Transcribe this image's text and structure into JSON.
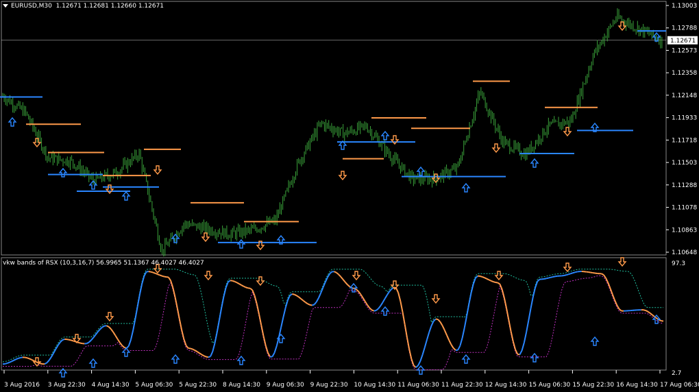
{
  "main_header": {
    "symbol": "EURUSD,M30",
    "ohlc": "1.12671 1.12681 1.12660 1.12671"
  },
  "indicator_header": {
    "text": "vkw bands of RSX (10,3,16,7) 56.9965 51.1367 46.4027 46.4027"
  },
  "price_axis": {
    "labels": [
      "1.13003",
      "1.12788",
      "1.12573",
      "1.12358",
      "1.12148",
      "1.11933",
      "1.11718",
      "1.11503",
      "1.11288",
      "1.11078",
      "1.10863",
      "1.10648"
    ],
    "current_price": "1.12671"
  },
  "indicator_axis": {
    "top": "97.3",
    "bottom": "2.7"
  },
  "time_axis": {
    "labels": [
      "3 Aug 2016",
      "3 Aug 22:30",
      "4 Aug 14:30",
      "5 Aug 06:30",
      "5 Aug 22:30",
      "8 Aug 14:30",
      "9 Aug 06:30",
      "9 Aug 22:30",
      "10 Aug 14:30",
      "11 Aug 06:30",
      "11 Aug 22:30",
      "12 Aug 14:30",
      "15 Aug 06:30",
      "15 Aug 22:30",
      "16 Aug 14:30",
      "17 Aug 06:30"
    ]
  },
  "colors": {
    "background": "#000000",
    "candles": "#3aa33a",
    "resistance": "#ff9a4a",
    "support": "#2a86ff",
    "rsx_up": "#2a86ff",
    "rsx_down": "#ff9a4a",
    "band_upper": "#20c0a0",
    "band_lower": "#c030c0",
    "axis_text": "#ffffff",
    "grid": "#cccccc"
  },
  "chart_data": {
    "type": "line",
    "title": "EURUSD,M30",
    "x": [
      "3 Aug 2016",
      "3 Aug 22:30",
      "4 Aug 14:30",
      "5 Aug 06:30",
      "5 Aug 22:30",
      "8 Aug 14:30",
      "9 Aug 06:30",
      "9 Aug 22:30",
      "10 Aug 14:30",
      "11 Aug 06:30",
      "11 Aug 22:30",
      "12 Aug 14:30",
      "15 Aug 06:30",
      "15 Aug 22:30",
      "16 Aug 14:30",
      "17 Aug 06:30"
    ],
    "ylim": [
      1.10648,
      1.13003
    ],
    "series": [
      {
        "values": [
          1.1214,
          1.1198,
          1.1155,
          1.1152,
          1.1133,
          1.1141,
          1.1159,
          1.1066,
          1.1092,
          1.1087,
          1.1082,
          1.1086,
          1.1095,
          1.115,
          1.1188,
          1.1178,
          1.1185,
          1.1158,
          1.1135,
          1.1135,
          1.1145,
          1.1218,
          1.117,
          1.1158,
          1.1185,
          1.119,
          1.1254,
          1.1289,
          1.1278,
          1.1267
        ]
      }
    ],
    "indicator": {
      "ylim": [
        2.7,
        97.3
      ],
      "rsx": [
        8,
        14,
        8,
        30,
        26,
        42,
        22,
        90,
        85,
        22,
        14,
        82,
        75,
        14,
        70,
        60,
        90,
        75,
        55,
        76,
        5,
        48,
        20,
        86,
        80,
        16,
        83,
        86,
        90,
        88,
        55,
        56,
        46
      ]
    }
  }
}
